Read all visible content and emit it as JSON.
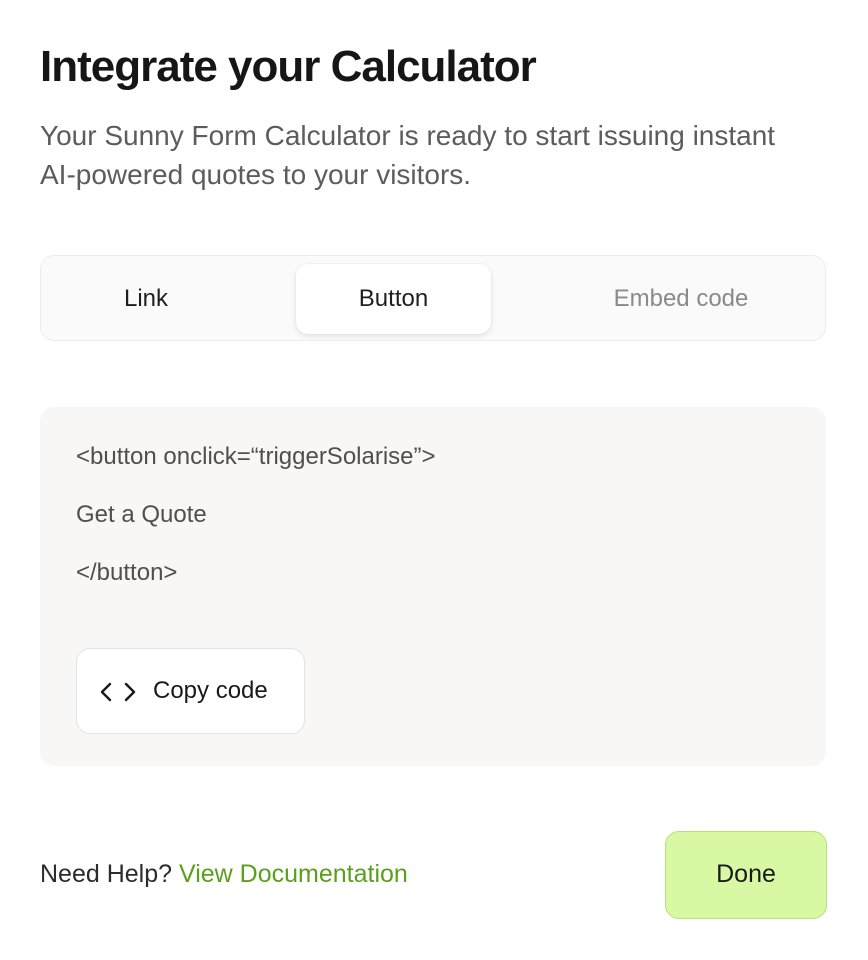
{
  "header": {
    "title": "Integrate your Calculator",
    "subtitle": "Your Sunny Form Calculator is ready to start issuing instant AI-powered quotes to your visitors."
  },
  "tabs": [
    {
      "label": "Link",
      "active": false
    },
    {
      "label": "Button",
      "active": true
    },
    {
      "label": "Embed code",
      "active": false
    }
  ],
  "code": {
    "lines": [
      "<button onclick=“triggerSolarise”>",
      "Get a Quote",
      "</button>"
    ],
    "copy_label": "Copy code",
    "copy_icon": "code-brackets-icon"
  },
  "footer": {
    "help_text": "Need Help?",
    "link_text": "View Documentation",
    "done_label": "Done"
  },
  "colors": {
    "link": "#5aa01a",
    "done_bg": "#d8f8a4",
    "done_border": "#b6e27c"
  }
}
